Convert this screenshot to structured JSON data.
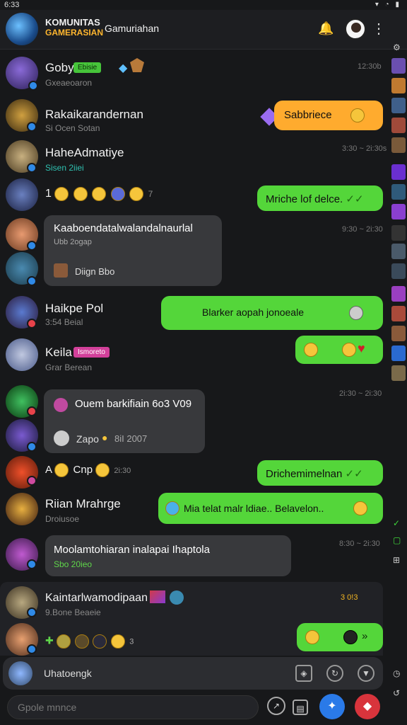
{
  "status": {
    "time": "6:33",
    "icons": "▾ ◔ ▮"
  },
  "header": {
    "title_line1": "KOMUNITAS",
    "title_line2": "GAMERASIAN",
    "subtitle": "Gamuriahan"
  },
  "messages": [
    {
      "name": "Goby",
      "tag": "Ebisie",
      "sub": "Gxeaeoaron",
      "time": "12:30b"
    },
    {
      "name": "Rakaikarandernan",
      "sub": "Si Ocen Sotan",
      "bubble": "Sabbriece"
    },
    {
      "name": "HaheAdmatiye",
      "sub": "Sisen 2iiei",
      "time": "3:30 ~ 2i:30s"
    },
    {
      "lead": "1",
      "count": "7",
      "bubble": "Mriche lof delce."
    },
    {
      "title": "Kaaboendatalwalandalnaurlal",
      "tagline": "Ubb 2ogap",
      "item": "Diign Bbo",
      "time": "9:30 ~ 2i:30"
    },
    {
      "name": "Haikpe Pol",
      "sub": "3:54 Beial",
      "bubble": "Blarker aopah jonoeale"
    },
    {
      "name": "Keila",
      "tag": "Ismoreto",
      "sub": "Grar Berean"
    },
    {
      "title": "Ouem barkifiain 6o3 V09",
      "item": "Zapo",
      "item2": "8iI 2007",
      "time": "2i:30 ~ 2i:30"
    },
    {
      "lead": "A",
      "word": "Cnp",
      "count": "2i:30",
      "bubble": "Drichemimelnan"
    },
    {
      "name": "Riian Mrahrge",
      "sub": "Droiusoe",
      "bubble": "Mia telat malr ldiae.. Belavelon.."
    },
    {
      "title": "Moolamtohiaran inalapai Ihaptola",
      "sub": "Sbo 20ieo",
      "time": "8:30 ~ 2i:30"
    },
    {
      "name": "Kaintarlwamodipaan",
      "sub": "9.Bone Beaeie",
      "time": "3 0!3"
    },
    {
      "count": "3"
    }
  ],
  "composer": {
    "text": "Uhatoengk"
  },
  "input": {
    "placeholder": "Gpole mnnce"
  },
  "colors": {
    "bubble_green": "#54d63a",
    "bubble_orange": "#ffab2e",
    "accent_yellow": "#f3b622"
  },
  "icons": [
    "bell-icon",
    "more-icon",
    "shield-icon",
    "refresh-icon",
    "microphone-icon",
    "compass-icon",
    "square-icon",
    "brand-blue-icon",
    "brand-red-icon",
    "check-icon"
  ]
}
